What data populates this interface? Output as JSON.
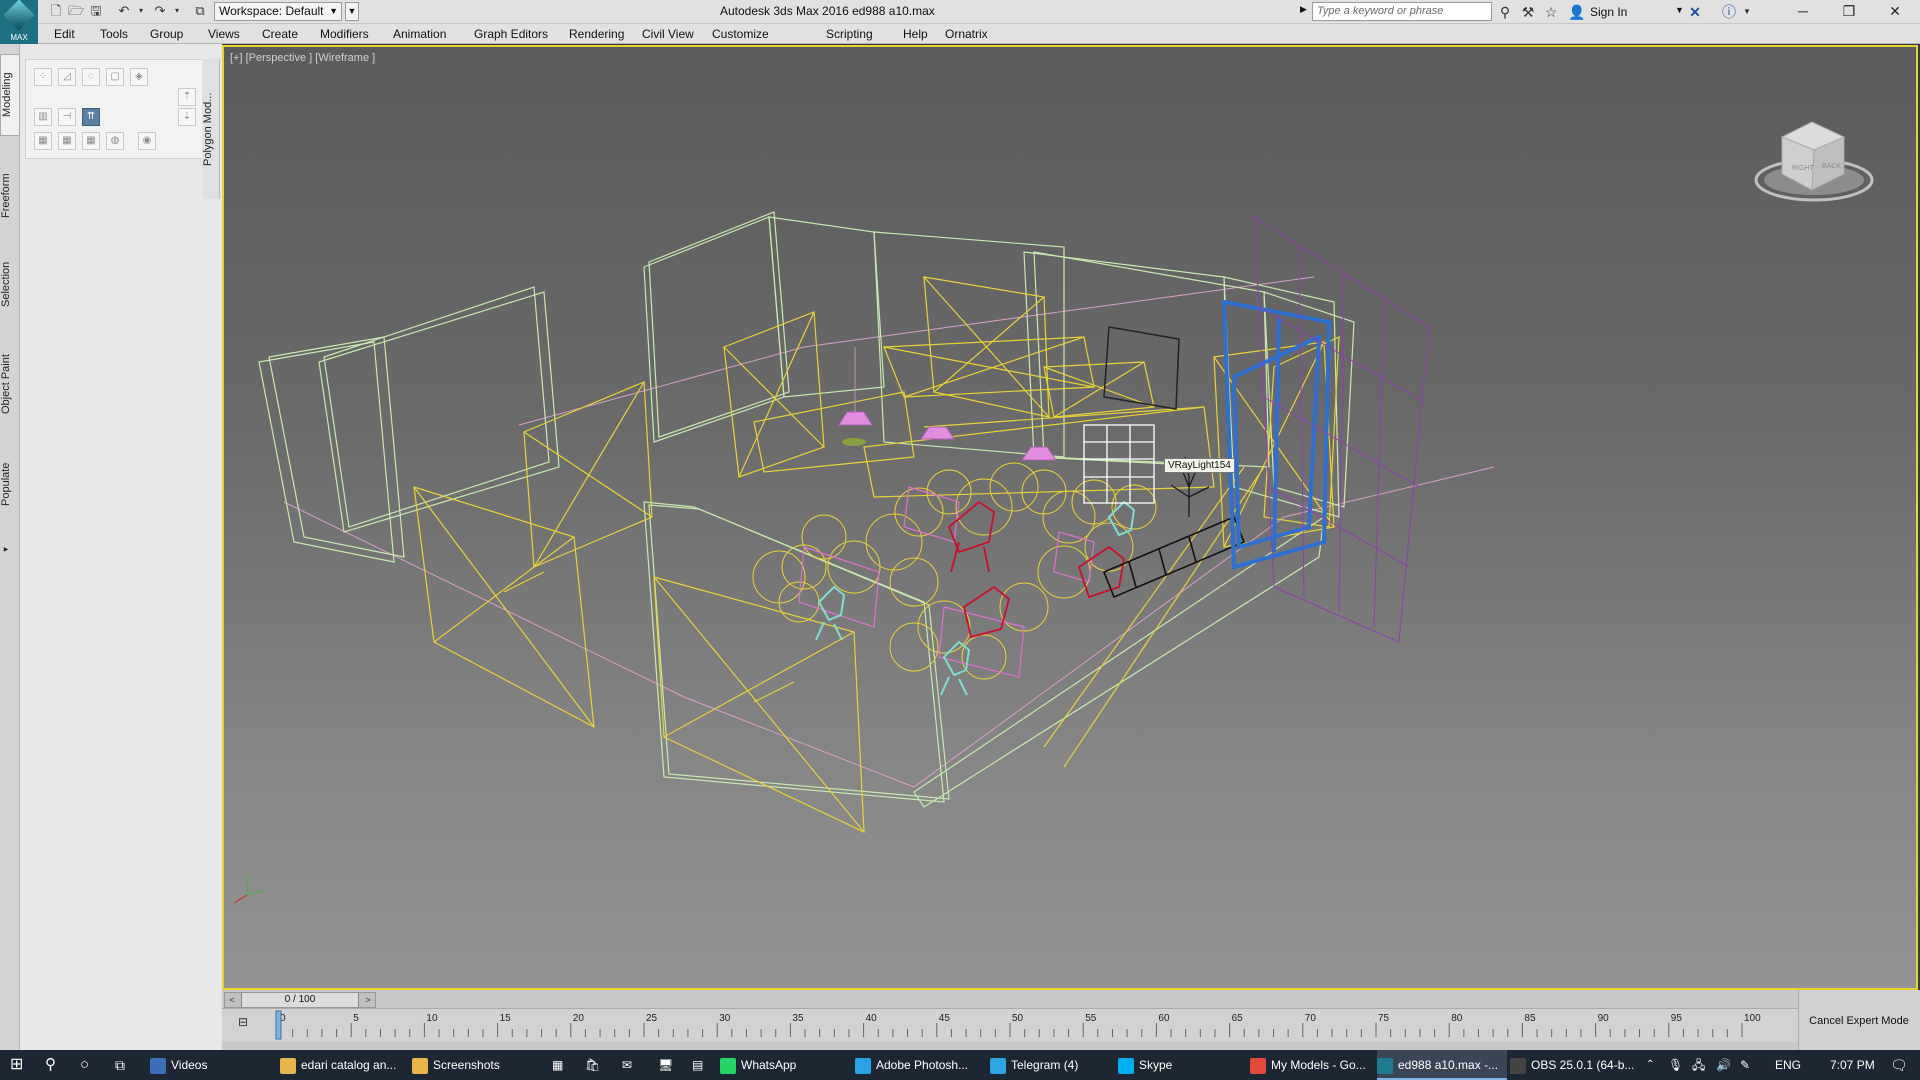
{
  "titlebar": {
    "logo_text": "MAX",
    "workspace": "Workspace: Default",
    "window_title": "Autodesk 3ds Max 2016     ed988 a10.max",
    "search_placeholder": "Type a keyword or phrase",
    "sign_in": "Sign In"
  },
  "menu": [
    "Edit",
    "Tools",
    "Group",
    "Views",
    "Create",
    "Modifiers",
    "Animation",
    "Graph Editors",
    "Rendering",
    "Civil View",
    "Customize",
    "Scripting",
    "Help",
    "Ornatrix"
  ],
  "ribbon": {
    "tabs": [
      "Modeling",
      "Freeform",
      "Selection",
      "Object Paint",
      "Populate"
    ],
    "active_tab": "Modeling",
    "panel_tab": "Polygon Mod..."
  },
  "viewport": {
    "label": "[+] [Perspective ] [Wireframe ]",
    "hover_label": "VRayLight154",
    "viewcube_faces": [
      "RIGHT",
      "BACK"
    ]
  },
  "timeline": {
    "frame_display": "0 / 100",
    "ticks": [
      "0",
      "5",
      "10",
      "15",
      "20",
      "25",
      "30",
      "35",
      "40",
      "45",
      "50",
      "55",
      "60",
      "65",
      "70",
      "75",
      "80",
      "85",
      "90",
      "95",
      "100"
    ],
    "cancel_expert": "Cancel Expert Mode"
  },
  "taskbar": {
    "apps": [
      {
        "label": "Videos",
        "color": "#3b6fb6"
      },
      {
        "label": "edari catalog an...",
        "color": "#e8b64a"
      },
      {
        "label": "Screenshots",
        "color": "#e8b64a"
      },
      {
        "label": "WhatsApp",
        "color": "#25d366"
      },
      {
        "label": "Adobe Photosh...",
        "color": "#2aa3e6"
      },
      {
        "label": "Telegram (4)",
        "color": "#2ca5e0"
      },
      {
        "label": "Skype",
        "color": "#00aff0"
      },
      {
        "label": "My Models - Go...",
        "color": "#e24b3b"
      },
      {
        "label": "ed988 a10.max -...",
        "color": "#1f7c8f"
      },
      {
        "label": "OBS 25.0.1 (64-b...",
        "color": "#444444"
      }
    ],
    "language": "ENG",
    "time": "7:07 PM"
  }
}
